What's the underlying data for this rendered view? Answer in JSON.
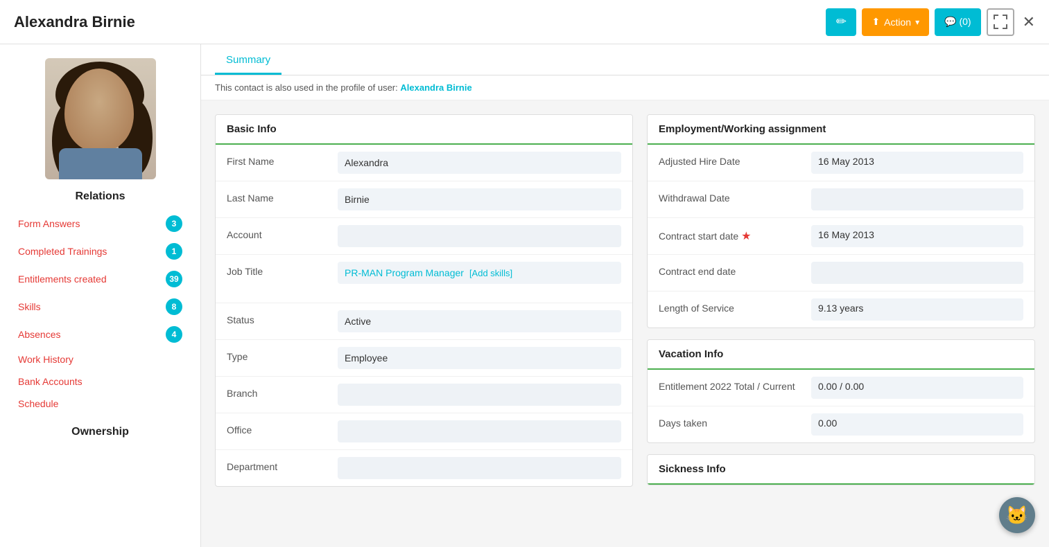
{
  "header": {
    "title": "Alexandra Birnie",
    "edit_icon": "✏",
    "action_label": "Action",
    "comment_label": "💬 (0)",
    "expand_icon": "⛶",
    "close_icon": "✕"
  },
  "tabs": [
    {
      "label": "Summary",
      "active": true
    }
  ],
  "notice": {
    "text": "This contact is also used in the profile of user:",
    "user_link": "Alexandra Birnie"
  },
  "sidebar": {
    "relations_title": "Relations",
    "items": [
      {
        "label": "Form Answers",
        "badge": "3"
      },
      {
        "label": "Completed Trainings",
        "badge": "1"
      },
      {
        "label": "Entitlements created",
        "badge": "39"
      },
      {
        "label": "Skills",
        "badge": "8"
      },
      {
        "label": "Absences",
        "badge": "4"
      },
      {
        "label": "Work History",
        "badge": null
      },
      {
        "label": "Bank Accounts",
        "badge": null
      },
      {
        "label": "Schedule",
        "badge": null
      }
    ],
    "ownership_title": "Ownership"
  },
  "basic_info": {
    "section_title": "Basic Info",
    "fields": [
      {
        "label": "First Name",
        "value": "Alexandra"
      },
      {
        "label": "Last Name",
        "value": "Birnie"
      },
      {
        "label": "Account",
        "value": ""
      },
      {
        "label": "Job Title",
        "value": "PR-MAN Program Manager",
        "is_link": true,
        "add_skills": "[Add skills]"
      },
      {
        "label": "Status",
        "value": "Active"
      },
      {
        "label": "Type",
        "value": "Employee"
      },
      {
        "label": "Branch",
        "value": ""
      },
      {
        "label": "Office",
        "value": ""
      },
      {
        "label": "Department",
        "value": ""
      }
    ]
  },
  "employment": {
    "section_title": "Employment/Working assignment",
    "fields": [
      {
        "label": "Adjusted Hire Date",
        "value": "16 May 2013",
        "required": false
      },
      {
        "label": "Withdrawal Date",
        "value": "",
        "required": false
      },
      {
        "label": "Contract start date",
        "value": "16 May 2013",
        "required": true
      },
      {
        "label": "Contract end date",
        "value": "",
        "required": false
      },
      {
        "label": "Length of Service",
        "value": "9.13 years",
        "required": false
      }
    ]
  },
  "vacation_info": {
    "section_title": "Vacation Info",
    "fields": [
      {
        "label": "Entitlement 2022 Total / Current",
        "value": "0.00 / 0.00"
      },
      {
        "label": "Days taken",
        "value": "0.00"
      }
    ]
  },
  "sickness_info": {
    "section_title": "Sickness Info"
  }
}
